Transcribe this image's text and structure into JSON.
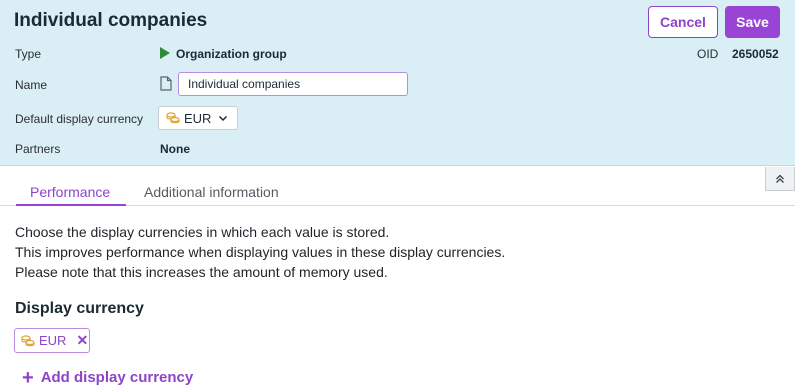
{
  "header": {
    "title": "Individual companies",
    "cancel_label": "Cancel",
    "save_label": "Save",
    "type_label": "Type",
    "type_value": "Organization group",
    "oid_label": "OID",
    "oid_value": "2650052",
    "name_label": "Name",
    "name_value": "Individual companies",
    "currency_label": "Default display currency",
    "currency_value": "EUR",
    "partners_label": "Partners",
    "partners_value": "None"
  },
  "tabs": [
    {
      "label": "Performance",
      "active": true
    },
    {
      "label": "Additional information",
      "active": false
    }
  ],
  "content": {
    "description": [
      "Choose the display currencies in which each value is stored.",
      "This improves performance when displaying values in these display currencies.",
      "Please note that this increases the amount of memory used."
    ],
    "section_title": "Display currency",
    "chips": [
      {
        "code": "EUR"
      }
    ],
    "add_label": "Add display currency"
  },
  "icons": {
    "type": "play-triangle-icon",
    "name": "document-icon",
    "currency": "coins-icon",
    "collapse": "chevron-double-up-icon"
  },
  "colors": {
    "accent": "#9845d6",
    "header_bg": "#d9eef5",
    "group_icon": "#2e8b3a",
    "coins": "#e0a43a"
  }
}
